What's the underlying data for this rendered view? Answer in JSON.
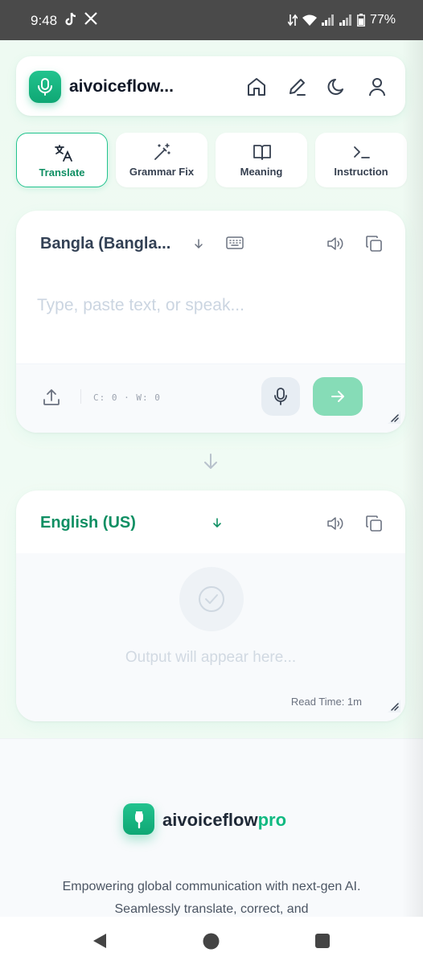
{
  "status_bar": {
    "time": "9:48",
    "battery": "77%",
    "icons": [
      "tiktok-icon",
      "x-icon",
      "data-arrows-icon",
      "wifi-icon",
      "signal-icon",
      "signal-icon",
      "battery-icon"
    ]
  },
  "header": {
    "brand": "aivoiceflow...",
    "icons": [
      "home-icon",
      "edit-icon",
      "moon-icon",
      "user-icon"
    ]
  },
  "tabs": [
    {
      "label": "Translate",
      "icon": "translate-icon",
      "active": true
    },
    {
      "label": "Grammar Fix",
      "icon": "magic-wand-icon",
      "active": false
    },
    {
      "label": "Meaning",
      "icon": "book-icon",
      "active": false
    },
    {
      "label": "Instruction",
      "icon": "terminal-icon",
      "active": false
    }
  ],
  "input_card": {
    "language": "Bangla (Bangla...",
    "placeholder": "Type, paste text, or speak...",
    "counter": "C: 0 · W: 0"
  },
  "output_card": {
    "language": "English (US)",
    "placeholder": "Output will appear here...",
    "read_time": "Read Time: 1m"
  },
  "footer": {
    "brand_main": "aivoiceflow",
    "brand_accent": "pro",
    "description": "Empowering global communication with next-gen AI. Seamlessly translate, correct, and"
  },
  "colors": {
    "accent": "#10b981",
    "accent_dark": "#0f8f63",
    "send_button": "#86dcb7",
    "background": "#eef9f2"
  }
}
